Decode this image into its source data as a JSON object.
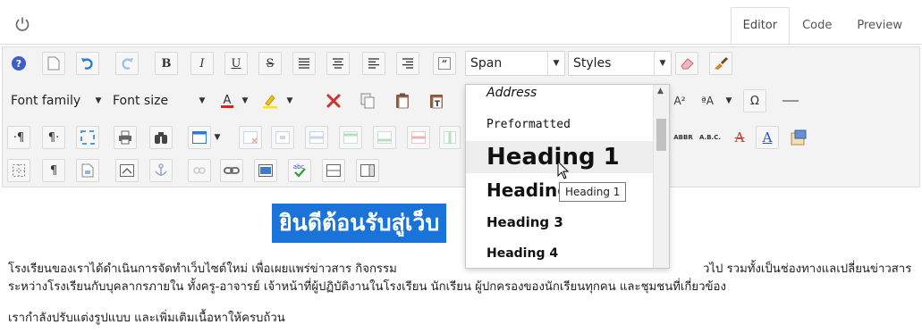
{
  "tabs": [
    {
      "label": "Editor",
      "active": true
    },
    {
      "label": "Code",
      "active": false
    },
    {
      "label": "Preview",
      "active": false
    }
  ],
  "toolbar": {
    "format_select": "Span",
    "styles_select": "Styles",
    "font_family": "Font family",
    "font_size": "Font size",
    "bold": "B",
    "italic": "I",
    "underline": "U",
    "strikethrough": "S",
    "abbr": "ABBR",
    "acronym": "A.B.C."
  },
  "format_dropdown": {
    "items": [
      {
        "label": "Address"
      },
      {
        "label": "Preformatted"
      },
      {
        "label": "Heading 1"
      },
      {
        "label": "Heading 2"
      },
      {
        "label": "Heading 3"
      },
      {
        "label": "Heading 4"
      }
    ],
    "hovered": "Heading 1",
    "tooltip": "Heading 1"
  },
  "content": {
    "heading": "ยินดีต้อนรับสู่เว็บ",
    "paragraph1_line1_a": "โรงเรียนของเราได้ดำเนินการจัดทำเว็บไซต์ใหม่   เพื่อเผยแพร่ข่าวสาร   กิจกรรม",
    "paragraph1_line1_b": "วไป   รวมทั้งเป็นช่องทางแลเปลี่ยนข่าวสาร",
    "paragraph1_line2": "ระหว่างโรงเรียนกับบุคลากรภายใน ทั้งครู-อาจารย์ เจ้าหน้าที่ผู้ปฏิบัติงานในโรงเรียน นักเรียน ผู้ปกครองของนักเรียนทุกคน และชุมชนที่เกี่ยวข้อง",
    "paragraph2": "เรากำลังปรับแต่งรูปแบบ และเพิ่มเติมเนื้อหาให้ครบถ้วน"
  },
  "colors": {
    "accent": "#1a73d9",
    "toolbar_bg": "#f3f3f3"
  }
}
